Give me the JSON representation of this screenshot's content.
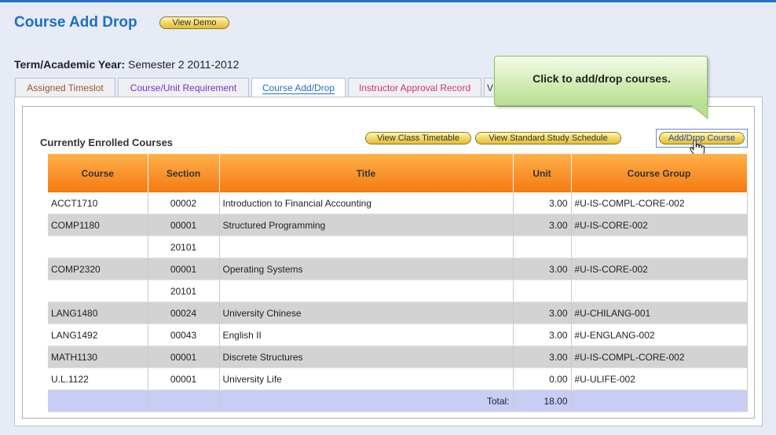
{
  "header": {
    "title": "Course Add Drop",
    "demo_label": "View Demo"
  },
  "term": {
    "label": "Term/Academic Year:",
    "value": "Semester 2 2011-2012"
  },
  "tabs": [
    {
      "label": "Assigned Timeslot",
      "color": "#a0522d"
    },
    {
      "label": "Course/Unit Requirement",
      "color": "#7b2fbf"
    },
    {
      "label": "Course Add/Drop",
      "color": "#1f6fc0",
      "active": true
    },
    {
      "label": "Instructor Approval Record",
      "color": "#d6336c"
    },
    {
      "label": "V",
      "color": "#333333"
    }
  ],
  "enrolled": {
    "heading": "Currently Enrolled Courses",
    "buttons": {
      "timetable": "View Class Timetable",
      "schedule": "View Standard Study Schedule",
      "add_drop": "Add/Drop Course"
    },
    "columns": [
      "Course",
      "Section",
      "Title",
      "Unit",
      "Course Group"
    ],
    "rows": [
      {
        "course": "ACCT1710",
        "section": "00002",
        "title": "Introduction to Financial Accounting",
        "unit": "3.00",
        "group": "#U-IS-COMPL-CORE-002"
      },
      {
        "course": "COMP1180",
        "section": "00001",
        "title": "Structured Programming",
        "unit": "3.00",
        "group": "#U-IS-CORE-002"
      },
      {
        "course": "",
        "section": "20101",
        "title": "",
        "unit": "",
        "group": ""
      },
      {
        "course": "COMP2320",
        "section": "00001",
        "title": "Operating Systems",
        "unit": "3.00",
        "group": "#U-IS-CORE-002"
      },
      {
        "course": "",
        "section": "20101",
        "title": "",
        "unit": "",
        "group": ""
      },
      {
        "course": "LANG1480",
        "section": "00024",
        "title": "University Chinese",
        "unit": "3.00",
        "group": "#U-CHILANG-001"
      },
      {
        "course": "LANG1492",
        "section": "00043",
        "title": "English II",
        "unit": "3.00",
        "group": "#U-ENGLANG-002"
      },
      {
        "course": "MATH1130",
        "section": "00001",
        "title": "Discrete Structures",
        "unit": "3.00",
        "group": "#U-IS-COMPL-CORE-002"
      },
      {
        "course": "U.L.1122",
        "section": "00001",
        "title": "University Life",
        "unit": "0.00",
        "group": "#U-ULIFE-002"
      }
    ],
    "total": {
      "label": "Total:",
      "value": "18.00"
    }
  },
  "callout": {
    "text": "Click to add/drop courses."
  },
  "colors": {
    "accent": "#1f6fc0",
    "header_orange": "#f47a12",
    "total_row": "#c9cdf3",
    "callout_green": "#c9e8a8",
    "button_gold": "#f0d25a"
  }
}
